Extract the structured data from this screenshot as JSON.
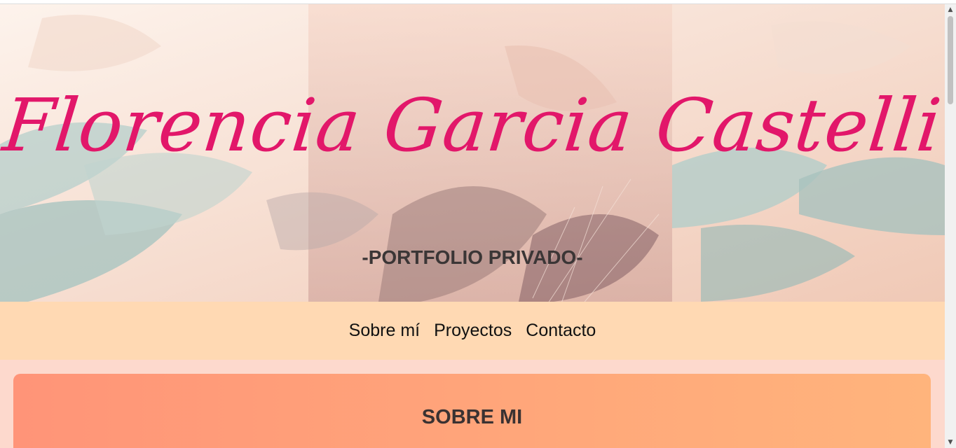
{
  "hero": {
    "title": "Florencia Garcia Castelli",
    "subtitle": "-PORTFOLIO PRIVADO-"
  },
  "nav": {
    "items": [
      {
        "label": "Sobre mí"
      },
      {
        "label": "Proyectos"
      },
      {
        "label": "Contacto"
      }
    ]
  },
  "section": {
    "title": "SOBRE MI"
  },
  "scrollbar": {
    "up_glyph": "▲",
    "down_glyph": "▼"
  },
  "colors": {
    "title_pink": "#e2176a",
    "nav_background": "#ffd9b3",
    "page_background": "#fdd9cd",
    "card_gradient_start": "#ff9478",
    "card_gradient_end": "#ffb47c"
  }
}
